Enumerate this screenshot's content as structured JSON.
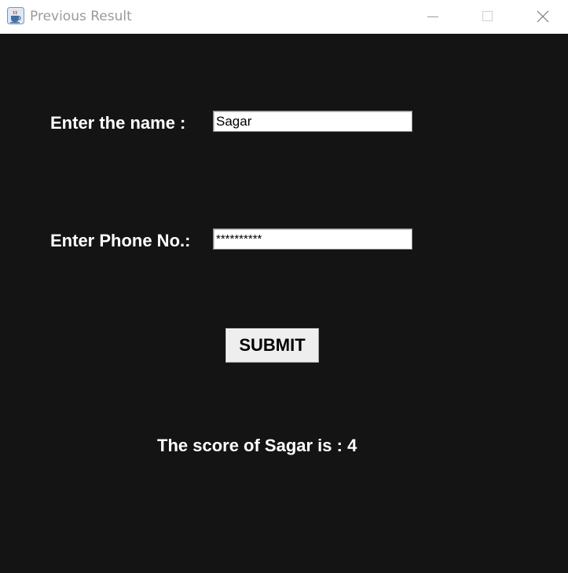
{
  "window": {
    "title": "Previous Result",
    "app_icon": "java-cup-icon",
    "controls": [
      "minimize-icon",
      "maximize-icon",
      "close-icon"
    ]
  },
  "form": {
    "name_label": "Enter the name :",
    "name_value": "Sagar",
    "phone_label": "Enter Phone No.:",
    "phone_value_masked": "**********",
    "submit_label": "SUBMIT"
  },
  "result": {
    "text": "The score of Sagar is : 4"
  },
  "colors": {
    "background": "#141414",
    "text": "#ffffff",
    "titlebar": "#ffffff",
    "title_text": "#9a9a9a"
  }
}
